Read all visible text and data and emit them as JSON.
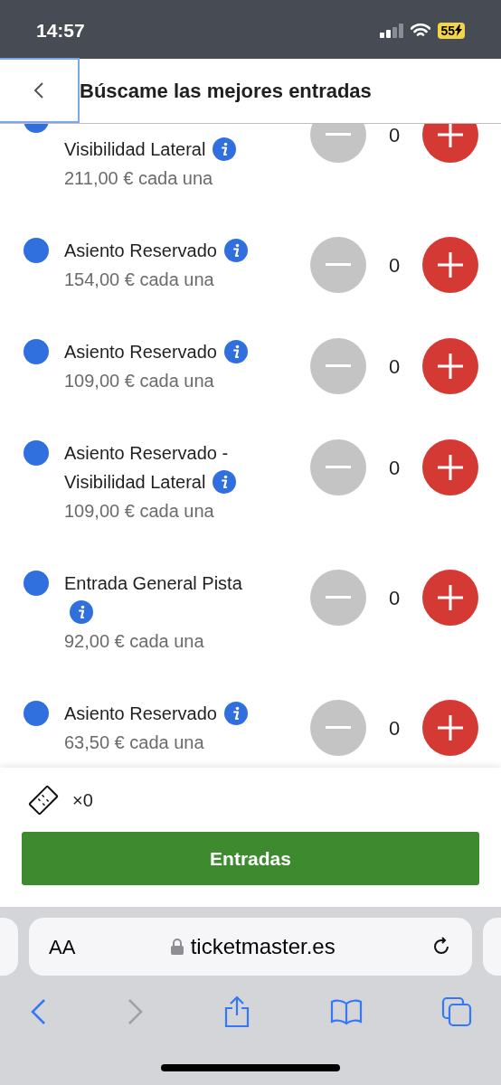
{
  "status_bar": {
    "time": "14:57",
    "battery": "55"
  },
  "header": {
    "title": "Búscame las mejores entradas"
  },
  "tickets": [
    {
      "name_lines": [
        "Visibilidad Lateral"
      ],
      "kind": "inline",
      "price": "211,00 € cada una",
      "count": "0",
      "partial": true
    },
    {
      "name_lines": [
        "Asiento Reservado"
      ],
      "kind": "inline",
      "price": "154,00 € cada una",
      "count": "0",
      "partial": false
    },
    {
      "name_lines": [
        "Asiento Reservado"
      ],
      "kind": "inline",
      "price": "109,00 € cada una",
      "count": "0",
      "partial": false
    },
    {
      "name_lines": [
        "Asiento Reservado -",
        "Visibilidad Lateral"
      ],
      "kind": "inline",
      "price": "109,00 € cada una",
      "count": "0",
      "partial": false
    },
    {
      "name_lines": [
        "Entrada General Pista"
      ],
      "kind": "wrapped",
      "price": "92,00 € cada una",
      "count": "0",
      "partial": false
    },
    {
      "name_lines": [
        "Asiento Reservado"
      ],
      "kind": "inline",
      "price": "63,50 € cada una",
      "count": "0",
      "partial": false
    }
  ],
  "footer": {
    "ticket_count": "×0",
    "button": "Entradas"
  },
  "browser": {
    "text_size": "AA",
    "url": "ticketmaster.es"
  }
}
